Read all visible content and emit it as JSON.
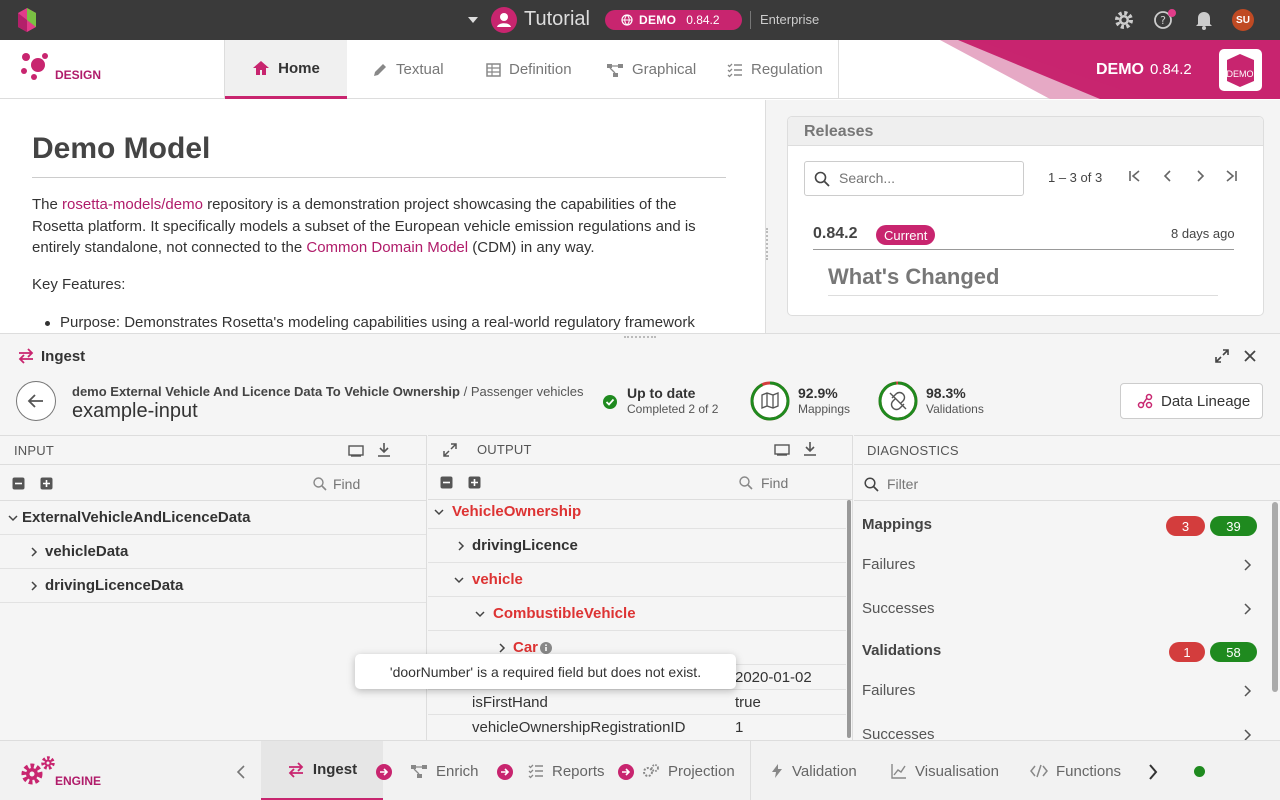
{
  "topbar": {
    "title": "Tutorial",
    "env_pill": "DEMO",
    "env_version": "0.84.2",
    "edition": "Enterprise",
    "avatar": "SU"
  },
  "nav": {
    "logo": "DESIGN",
    "tabs": [
      "Home",
      "Textual",
      "Definition",
      "Graphical",
      "Regulation"
    ],
    "brand_label": "DEMO",
    "brand_version": "0.84.2",
    "brand_logo": "DEMO"
  },
  "doc": {
    "title": "Demo Model",
    "p1_a": "The ",
    "p1_link1": "rosetta-models/demo",
    "p1_b": " repository is a demonstration project showcasing the capabilities of the Rosetta platform. It specifically models a subset of the European vehicle emission regulations and is entirely standalone, not connected to the ",
    "p1_link2": "Common Domain Model",
    "p1_c": " (CDM) in any way.",
    "p2": "Key Features:",
    "bullet": "Purpose: Demonstrates Rosetta's modeling capabilities using a real-world regulatory framework"
  },
  "releases": {
    "title": "Releases",
    "search_placeholder": "Search...",
    "range": "1 – 3 of 3",
    "version": "0.84.2",
    "current": "Current",
    "when": "8 days ago",
    "changed": "What's Changed"
  },
  "ingest": {
    "title": "Ingest",
    "breadcrumb_main": "demo External Vehicle And Licence Data To Vehicle Ownership",
    "breadcrumb_sep": " / ",
    "breadcrumb_sub": "Passenger vehicles",
    "subtitle": "example-input",
    "status_title": "Up to date",
    "status_sub": "Completed 2 of 2",
    "mappings_pct": "92.9%",
    "mappings_label": "Mappings",
    "mappings_fraction": 0.929,
    "validations_pct": "98.3%",
    "validations_label": "Validations",
    "validations_fraction": 0.983,
    "lineage": "Data Lineage"
  },
  "input": {
    "header": "INPUT",
    "find": "Find",
    "rows": [
      "ExternalVehicleAndLicenceData",
      "vehicleData",
      "drivingLicenceData"
    ]
  },
  "output": {
    "header": "OUTPUT",
    "find": "Find",
    "root": "VehicleOwnership",
    "driving": "drivingLicence",
    "vehicle": "vehicle",
    "combustible": "CombustibleVehicle",
    "car": "Car",
    "date_value": "2020-01-02",
    "first_hand_key": "isFirstHand",
    "first_hand_val": "true",
    "reg_key": "vehicleOwnershipRegistrationID",
    "reg_val": "1",
    "tooltip": "'doorNumber' is a required field but does not exist."
  },
  "diagnostics": {
    "header": "DIAGNOSTICS",
    "filter_placeholder": "Filter",
    "mappings": "Mappings",
    "mappings_fail": "3",
    "mappings_ok": "39",
    "validations": "Validations",
    "validations_fail": "1",
    "validations_ok": "58",
    "failures": "Failures",
    "successes": "Successes"
  },
  "footer": {
    "logo": "ENGINE",
    "tabs": [
      "Ingest",
      "Enrich",
      "Reports",
      "Projection",
      "Validation",
      "Visualisation",
      "Functions"
    ]
  },
  "colors": {
    "brand": "#c8256f",
    "ok": "#1f8a1f",
    "fail": "#d33d3d"
  }
}
